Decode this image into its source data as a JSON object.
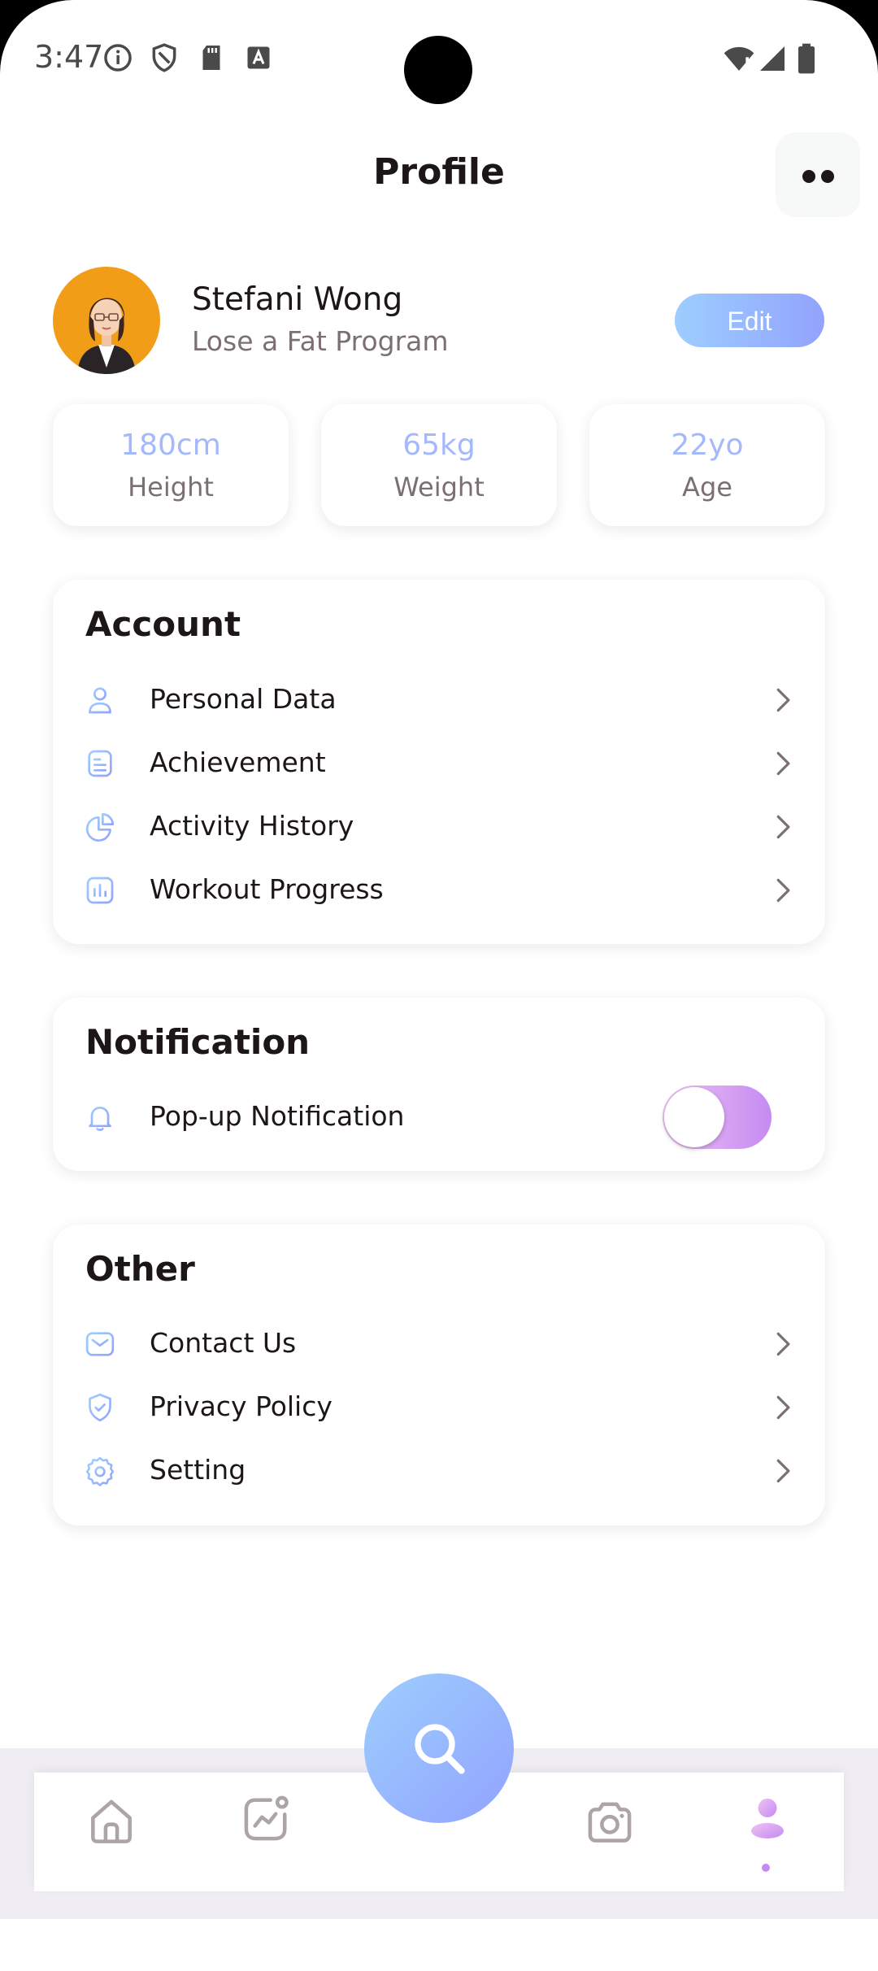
{
  "status_bar": {
    "time": "3:47"
  },
  "header": {
    "title": "Profile"
  },
  "profile": {
    "name": "Stefani Wong",
    "program": "Lose a Fat Program",
    "edit_label": "Edit"
  },
  "stats": [
    {
      "value": "180cm",
      "label": "Height"
    },
    {
      "value": "65kg",
      "label": "Weight"
    },
    {
      "value": "22yo",
      "label": "Age"
    }
  ],
  "account": {
    "title": "Account",
    "items": [
      {
        "label": "Personal Data",
        "icon": "user-icon"
      },
      {
        "label": "Achievement",
        "icon": "document-icon"
      },
      {
        "label": "Activity History",
        "icon": "pie-chart-icon"
      },
      {
        "label": "Workout Progress",
        "icon": "bar-chart-icon"
      }
    ]
  },
  "notification": {
    "title": "Notification",
    "items": [
      {
        "label": "Pop-up Notification",
        "icon": "bell-icon",
        "enabled": true
      }
    ]
  },
  "other": {
    "title": "Other",
    "items": [
      {
        "label": "Contact Us",
        "icon": "mail-icon"
      },
      {
        "label": "Privacy Policy",
        "icon": "shield-check-icon"
      },
      {
        "label": "Setting",
        "icon": "gear-icon"
      }
    ]
  },
  "bottom_nav": {
    "items": [
      "home-icon",
      "activity-icon",
      "search-icon",
      "camera-icon",
      "profile-icon"
    ],
    "active": "profile-icon"
  },
  "colors": {
    "accent_blue": "#92A3FD",
    "light_blue": "#9DCEFF",
    "accent_purple": "#C58BF2",
    "text_dark": "#1D1617",
    "text_gray": "#7B6F72"
  }
}
